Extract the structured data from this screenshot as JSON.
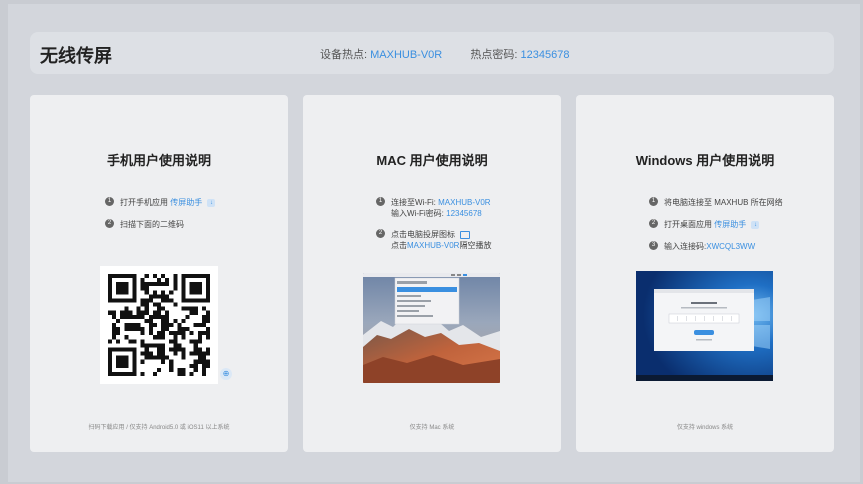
{
  "header": {
    "title": "无线传屏",
    "hotspot_label": "设备热点:",
    "hotspot_value": "MAXHUB-V0R",
    "password_label": "热点密码:",
    "password_value": "12345678"
  },
  "mobile": {
    "title": "手机用户使用说明",
    "step1_num": "1",
    "step1_text": "打开手机应用",
    "step1_link": "传屏助手",
    "step2_num": "2",
    "step2_text": "扫描下面的二维码",
    "footer": "扫码下载应用 / 仅支持 Android5.0 或 iOS11 以上系统",
    "icons": [
      "download-icon",
      "qr-code",
      "zoom-icon"
    ]
  },
  "mac": {
    "title": "MAC 用户使用说明",
    "step1_num": "1",
    "step1_line1_prefix": "连接至Wi-Fi:",
    "step1_line1_value": "MAXHUB-V0R",
    "step1_line2_prefix": "输入Wi-Fi密码:",
    "step1_line2_value": "12345678",
    "step2_num": "2",
    "step2_line1": "点击电脑投屏图标",
    "step2_line2_link": "MAXHUB-V0R",
    "step2_line2_prefix": "点击",
    "step2_line2_suffix": "隔空播放",
    "footer": "仅支持 Mac 系统",
    "icons": [
      "airplay-icon"
    ]
  },
  "windows": {
    "title": "Windows 用户使用说明",
    "step1_num": "1",
    "step1_text": "将电脑连接至 MAXHUB 所在网络",
    "step2_num": "2",
    "step2_text": "打开桌面应用",
    "step2_link": "传屏助手",
    "step3_num": "3",
    "step3_text": "输入连接码:",
    "step3_value": "XWCQL3WW",
    "footer": "仅支持 windows 系统",
    "icons": [
      "download-icon"
    ]
  },
  "colors": {
    "accent": "#3a8fe0",
    "background": "#c9ccd2",
    "card": "#eeeff1"
  }
}
